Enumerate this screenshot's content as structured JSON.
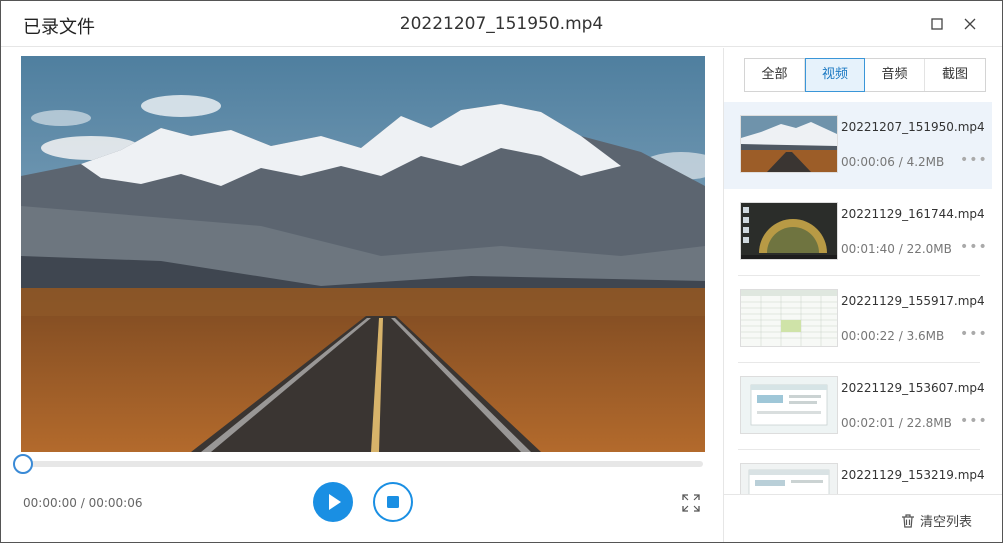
{
  "window": {
    "app_title": "已录文件",
    "file_title": "20221207_151950.mp4"
  },
  "player": {
    "progress_fraction": 0.0,
    "time_current": "00:00:00",
    "time_total": "00:00:06",
    "time_separator": " / "
  },
  "sidebar": {
    "tabs": [
      {
        "label": "全部",
        "active": false
      },
      {
        "label": "视频",
        "active": true
      },
      {
        "label": "音频",
        "active": false
      },
      {
        "label": "截图",
        "active": false
      }
    ],
    "files": [
      {
        "name": "20221207_151950.mp4",
        "meta": "00:00:06 / 4.2MB",
        "selected": true,
        "thumb": "mountain-road"
      },
      {
        "name": "20221129_161744.mp4",
        "meta": "00:01:40 / 22.0MB",
        "selected": false,
        "thumb": "desktop-sunset"
      },
      {
        "name": "20221129_155917.mp4",
        "meta": "00:00:22 / 3.6MB",
        "selected": false,
        "thumb": "spreadsheet"
      },
      {
        "name": "20221129_153607.mp4",
        "meta": "00:02:01 / 22.8MB",
        "selected": false,
        "thumb": "app-window"
      },
      {
        "name": "20221129_153219.mp4",
        "meta": "",
        "selected": false,
        "thumb": "app-window"
      }
    ],
    "more_glyph": "•••",
    "clear_label": "清空列表"
  },
  "icons": {
    "maximize": "maximize-icon",
    "close": "close-icon",
    "play": "play-icon",
    "stop": "stop-icon",
    "fullscreen": "fullscreen-icon",
    "trash": "trash-icon",
    "more": "more-icon"
  },
  "colors": {
    "accent": "#1a8fe3",
    "active_tab_bg": "#e6f2fb",
    "selected_row_bg": "#edf3fa"
  }
}
